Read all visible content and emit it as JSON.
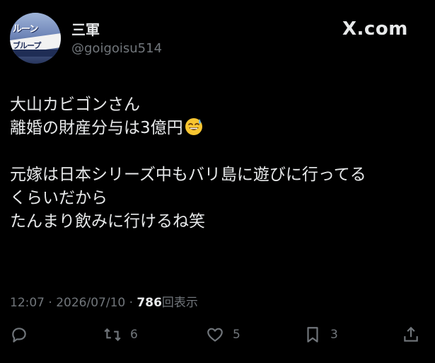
{
  "author": {
    "display_name": "三軍",
    "handle": "@goigoisu514",
    "avatar_text": [
      "ルーン",
      "ブループ"
    ]
  },
  "brand": {
    "logo_text": "X.com"
  },
  "tweet": {
    "lines": [
      "大山カビゴンさん",
      "離婚の財産分与は3億円",
      "",
      "元嫁は日本シリーズ中もバリ島に遊びに行ってる",
      "くらいだから",
      "たんまり飲みに行けるね笑"
    ],
    "emoji": "sweat-smile-emoji"
  },
  "meta": {
    "time": "12:07",
    "date": "2026/07/10",
    "separator": "·",
    "views_count": "786",
    "views_label": "回表示"
  },
  "actions": {
    "reply": {
      "icon": "reply-icon",
      "count": ""
    },
    "repost": {
      "icon": "repost-icon",
      "count": "6"
    },
    "like": {
      "icon": "heart-icon",
      "count": "5"
    },
    "bookmark": {
      "icon": "bookmark-icon",
      "count": "3"
    },
    "share": {
      "icon": "share-icon",
      "count": ""
    }
  },
  "colors": {
    "background": "#000000",
    "text": "#e7e9ea",
    "muted": "#71767b"
  }
}
